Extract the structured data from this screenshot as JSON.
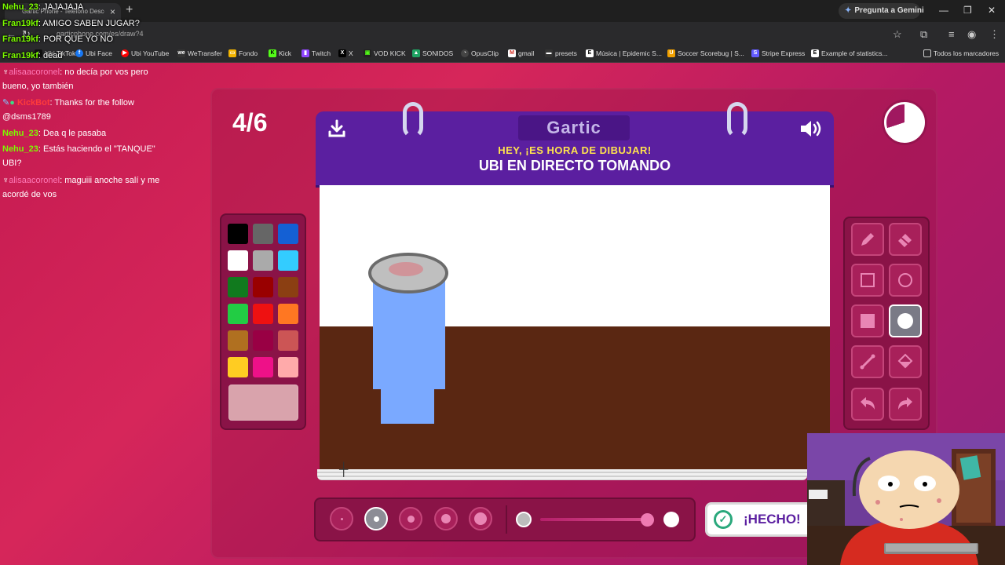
{
  "browser": {
    "tab_title": "Gartic Phone - Teléfono Descon...",
    "tab_close": "×",
    "new_tab": "+",
    "gemini_label": "Pregunta a Gemini",
    "url": "garticphone.com/es/draw?4",
    "win_min": "—",
    "win_max": "❐",
    "win_close": "✕",
    "bookmarks": [
      {
        "label": "Ubi TikTok"
      },
      {
        "label": "Ubi Face"
      },
      {
        "label": "Ubi YouTube"
      },
      {
        "label": "WeTransfer"
      },
      {
        "label": "Fondo"
      },
      {
        "label": "Kick"
      },
      {
        "label": "Twitch"
      },
      {
        "label": "X"
      },
      {
        "label": "VOD KICK"
      },
      {
        "label": "SONIDOS"
      },
      {
        "label": "OpusClip"
      },
      {
        "label": "gmail"
      },
      {
        "label": "presets"
      },
      {
        "label": "Música | Epidemic S..."
      },
      {
        "label": "Soccer Scorebug | S..."
      },
      {
        "label": "Stripe Express"
      },
      {
        "label": "Example of statistics..."
      }
    ],
    "all_bookmarks": "Todos los marcadores"
  },
  "chat": [
    {
      "user": "Nehu_23",
      "text": "JAJAJAJA"
    },
    {
      "user": "Fran19kf",
      "text": "AMIGO SABEN JUGAR?"
    },
    {
      "user": "Fran19kf",
      "text": "POR QUE YO NO"
    },
    {
      "user": "Fran19kf",
      "text": "dead"
    },
    {
      "user": "alisaacoronel",
      "text": "no decía por vos pero",
      "text2": "bueno, yo también"
    },
    {
      "user": "KickBot",
      "text": "Thanks for the follow",
      "text2": "@dsms1789"
    },
    {
      "user": "Nehu_23",
      "text": "Dea q le pasaba"
    },
    {
      "user": "Nehu_23",
      "text": "Estás haciendo el \"TANQUE\"",
      "text2": "UBI?"
    },
    {
      "user": "alisaacoronel",
      "text": "maguiii anoche salí y me",
      "text2": "acordé de vos"
    }
  ],
  "game": {
    "round": "4/6",
    "logo": "Gartic",
    "subtitle": "HEY, ¡ES HORA DE DIBUJAR!",
    "prompt": "UBI EN DIRECTO TOMANDO",
    "done_label": "¡HECHO!",
    "timer_remaining_fraction": 0.7,
    "palette": [
      "#000000",
      "#666666",
      "#1460d4",
      "#ffffff",
      "#aaaaaa",
      "#33ccff",
      "#117a1e",
      "#990000",
      "#8b3f12",
      "#22cc44",
      "#ee1111",
      "#ff7722",
      "#b07020",
      "#990044",
      "#cc5555",
      "#ffcc22",
      "#ee1188",
      "#ffaaaa"
    ],
    "current_color": "#d9a3ac",
    "tools": [
      "pencil-icon",
      "eraser-icon",
      "rectangle-outline-icon",
      "circle-outline-icon",
      "rectangle-filled-icon",
      "circle-filled-icon",
      "line-icon",
      "fill-bucket-icon",
      "undo-icon",
      "redo-icon"
    ],
    "active_tool": "circle-filled-icon",
    "brush_sizes": 5,
    "active_brush_size": 2,
    "opacity_level": 0.9
  }
}
